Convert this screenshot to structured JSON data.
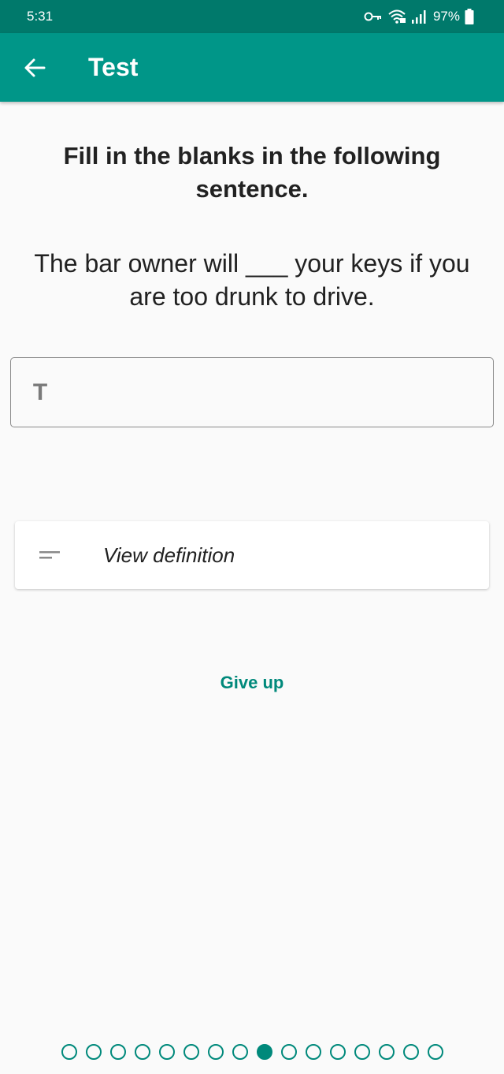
{
  "status": {
    "time": "5:31",
    "battery": "97%",
    "icons": [
      "key-icon",
      "wifi-icon",
      "signal-icon",
      "battery-icon"
    ]
  },
  "appbar": {
    "title": "Test",
    "back_icon": "arrow-left-icon",
    "color": "#009688"
  },
  "question": {
    "prompt": "Fill in the blanks in the following sentence.",
    "sentence": "The bar owner will ___ your keys if you are too drunk to drive."
  },
  "answer": {
    "icon_glyph": "T",
    "value": "",
    "placeholder": ""
  },
  "definition": {
    "label": "View definition",
    "icon": "short-text-icon"
  },
  "actions": {
    "give_up": "Give up"
  },
  "progress": {
    "total": 16,
    "current": 9,
    "accent": "#00897b"
  }
}
